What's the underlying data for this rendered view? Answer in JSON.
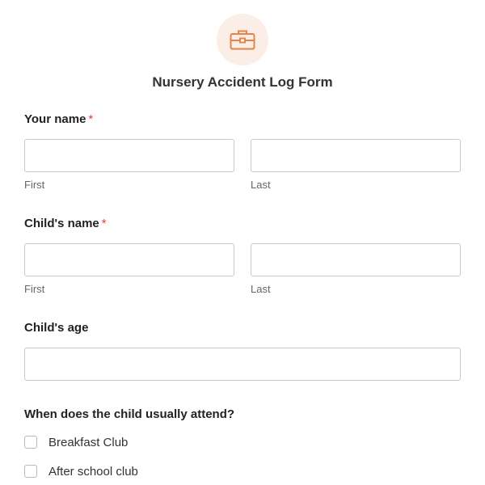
{
  "header": {
    "icon": "briefcase-icon",
    "accent_color": "#e5844a",
    "icon_bg_color": "#fbeee6",
    "title": "Nursery Accident Log Form"
  },
  "fields": {
    "your_name": {
      "label": "Your name",
      "required_mark": "*",
      "first_value": "",
      "last_value": "",
      "first_sublabel": "First",
      "last_sublabel": "Last"
    },
    "child_name": {
      "label": "Child's name",
      "required_mark": "*",
      "first_value": "",
      "last_value": "",
      "first_sublabel": "First",
      "last_sublabel": "Last"
    },
    "child_age": {
      "label": "Child's age",
      "value": ""
    },
    "attendance": {
      "label": "When does the child usually attend?",
      "options": [
        {
          "label": "Breakfast Club",
          "checked": false
        },
        {
          "label": "After school club",
          "checked": false
        }
      ]
    }
  },
  "colors": {
    "required": "#e03e2d",
    "input_border": "#c8c8c8"
  }
}
